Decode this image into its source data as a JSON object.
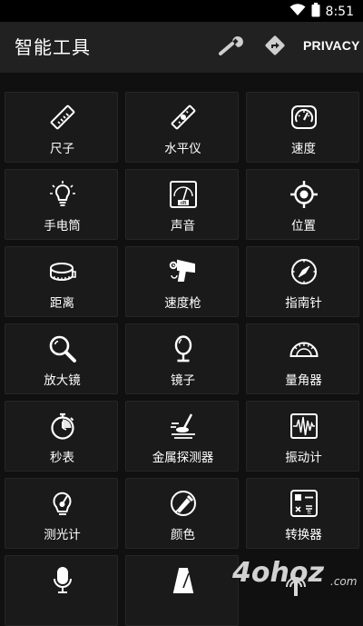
{
  "status": {
    "time": "8:51"
  },
  "appbar": {
    "title": "智能工具",
    "privacy_label": "PRIVACY",
    "wrench_icon": "wrench-icon",
    "directions_icon": "directions-icon"
  },
  "tools": [
    {
      "label": "尺子",
      "icon": "ruler-icon"
    },
    {
      "label": "水平仪",
      "icon": "level-icon"
    },
    {
      "label": "速度",
      "icon": "speedometer-icon"
    },
    {
      "label": "手电筒",
      "icon": "bulb-icon"
    },
    {
      "label": "声音",
      "icon": "db-meter-icon"
    },
    {
      "label": "位置",
      "icon": "gps-target-icon"
    },
    {
      "label": "距离",
      "icon": "tape-measure-icon"
    },
    {
      "label": "速度枪",
      "icon": "speed-gun-icon"
    },
    {
      "label": "指南针",
      "icon": "compass-icon"
    },
    {
      "label": "放大镜",
      "icon": "magnifier-icon"
    },
    {
      "label": "镜子",
      "icon": "mirror-icon"
    },
    {
      "label": "量角器",
      "icon": "protractor-icon"
    },
    {
      "label": "秒表",
      "icon": "stopwatch-icon"
    },
    {
      "label": "金属探测器",
      "icon": "metal-detector-icon"
    },
    {
      "label": "振动计",
      "icon": "vibrometer-icon"
    },
    {
      "label": "测光计",
      "icon": "light-meter-icon"
    },
    {
      "label": "颜色",
      "icon": "color-picker-icon"
    },
    {
      "label": "转换器",
      "icon": "converter-icon"
    },
    {
      "label": "",
      "icon": "microphone-icon"
    },
    {
      "label": "",
      "icon": "metronome-icon"
    }
  ],
  "watermark": {
    "text": "4ohoz.com"
  }
}
